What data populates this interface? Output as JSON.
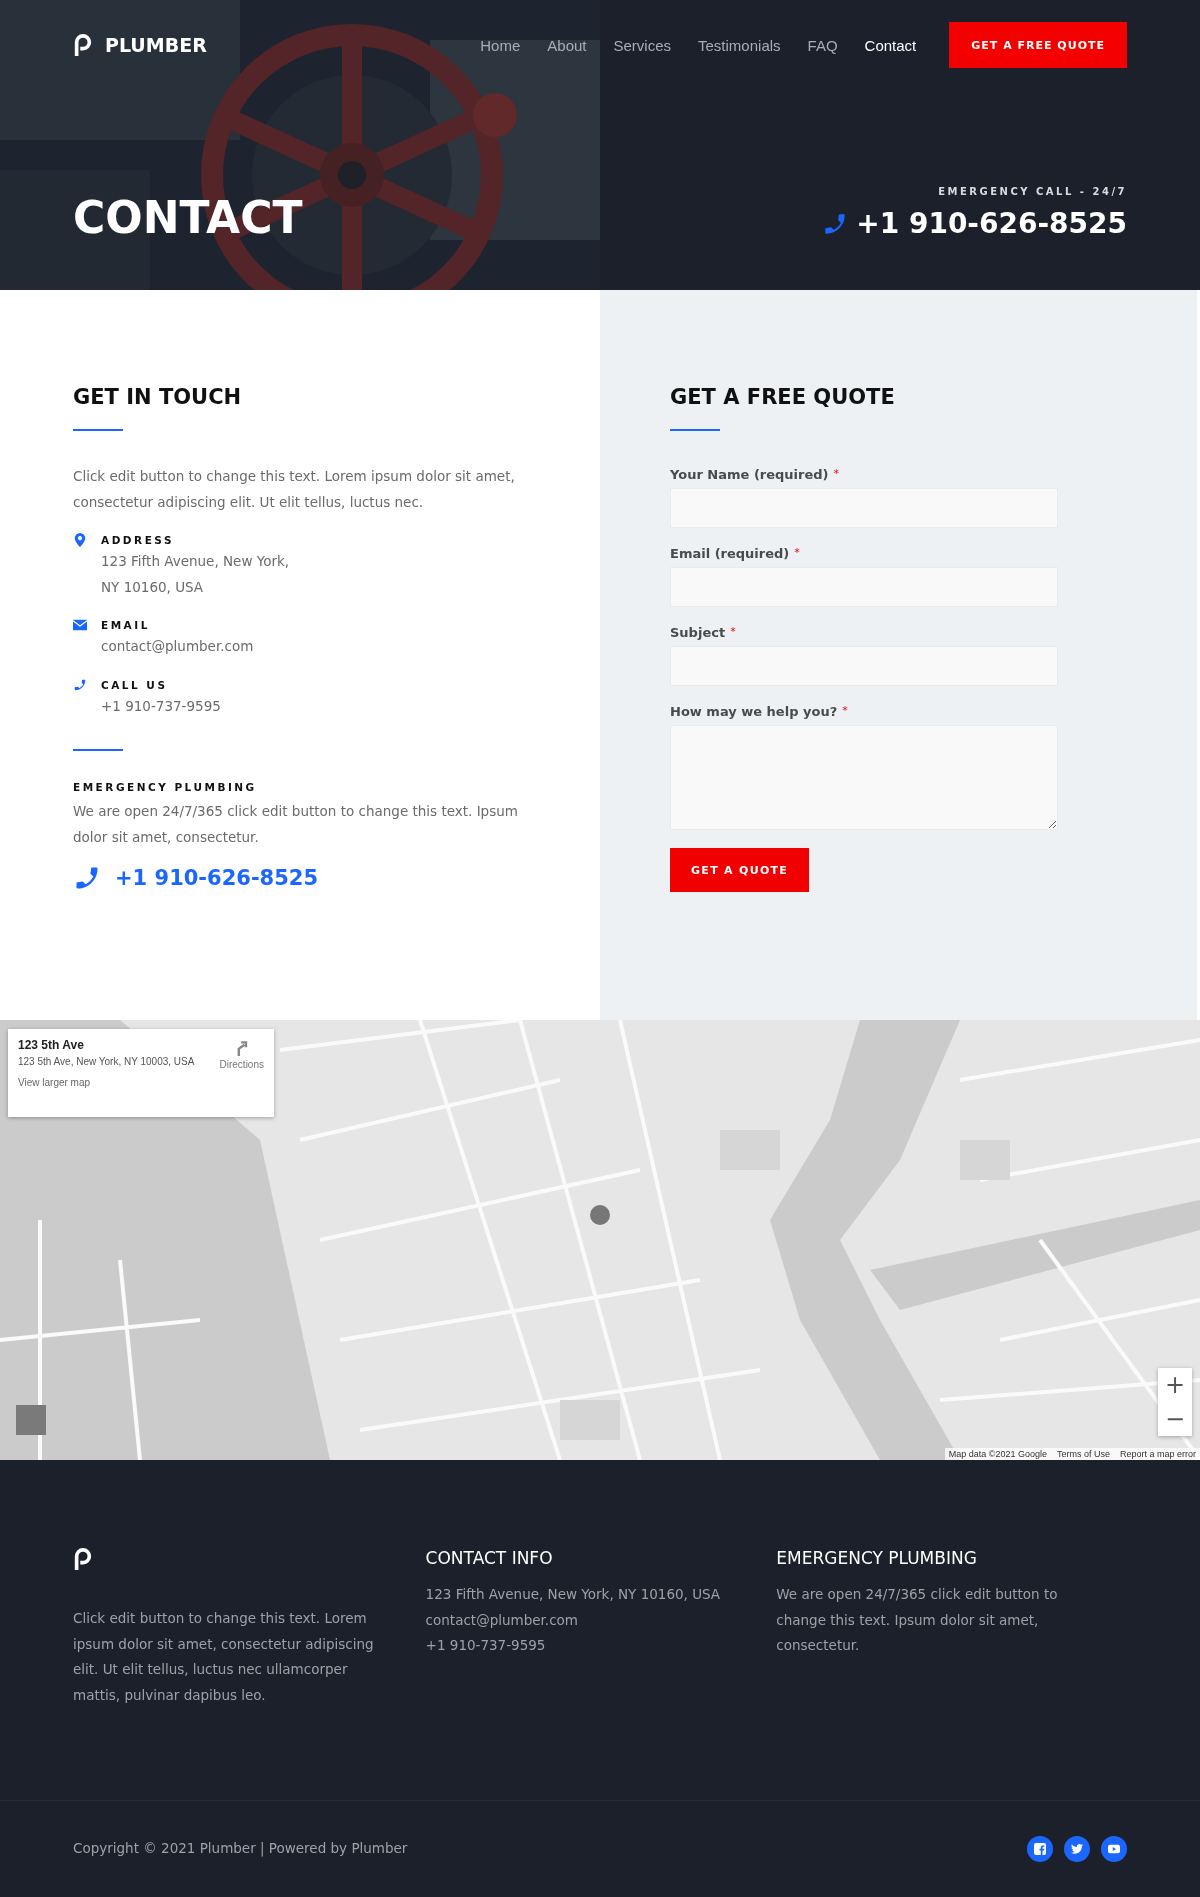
{
  "header": {
    "logo": "PLUMBER",
    "nav": [
      {
        "label": "Home",
        "selected": false
      },
      {
        "label": "About",
        "selected": false
      },
      {
        "label": "Services",
        "selected": false
      },
      {
        "label": "Testimonials",
        "selected": false
      },
      {
        "label": "FAQ",
        "selected": false
      },
      {
        "label": "Contact",
        "selected": true
      }
    ],
    "cta": "GET A FREE QUOTE",
    "page_title": "CONTACT",
    "emergency_label": "EMERGENCY CALL - 24/7",
    "emergency_phone": "+1 910-626-8525"
  },
  "get_in_touch": {
    "title": "GET IN TOUCH",
    "intro": "Click edit button to change this text. Lorem ipsum dolor sit amet, consectetur adipiscing elit. Ut elit tellus, luctus nec.",
    "items": [
      {
        "kind": "address",
        "label": "ADDRESS",
        "lines": [
          "123 Fifth Avenue, New York,",
          "NY 10160, USA"
        ]
      },
      {
        "kind": "email",
        "label": "EMAIL",
        "lines": [
          "contact@plumber.com"
        ]
      },
      {
        "kind": "phone",
        "label": "CALL US",
        "lines": [
          "+1 910-737-9595"
        ]
      }
    ],
    "emergency_title": "EMERGENCY PLUMBING",
    "emergency_text": "We are open 24/7/365 click edit button to change this text. Ipsum dolor sit amet, consectetur.",
    "phone": "+1 910-626-8525"
  },
  "quote_form": {
    "title": "GET A FREE QUOTE",
    "fields": [
      {
        "kind": "text",
        "label": "Your Name (required)",
        "required_mark": "*"
      },
      {
        "kind": "text",
        "label": "Email (required)",
        "required_mark": "*"
      },
      {
        "kind": "text",
        "label": "Subject",
        "required_mark": "*"
      },
      {
        "kind": "textarea",
        "label": "How may we help you?",
        "required_mark": "*"
      }
    ],
    "submit": "GET A QUOTE"
  },
  "map": {
    "place_title": "123 5th Ave",
    "place_address": "123 5th Ave, New York, NY 10003, USA",
    "directions": "Directions",
    "larger_map": "View larger map",
    "zoom_in": "+",
    "zoom_out": "−",
    "attribution": [
      "Map data ©2021 Google",
      "Terms of Use",
      "Report a map error"
    ]
  },
  "footer": {
    "about": "Click edit button to change this text. Lorem ipsum dolor sit amet, consectetur adipiscing elit. Ut elit tellus, luctus nec ullamcorper mattis, pulvinar dapibus leo.",
    "contact_title": "CONTACT INFO",
    "contact_lines": [
      "123 Fifth Avenue, New York, NY 10160, USA",
      "contact@plumber.com",
      "+1 910-737-9595"
    ],
    "emergency_title": "EMERGENCY PLUMBING",
    "emergency_text": "We are open 24/7/365 click edit button to change this text. Ipsum dolor sit amet, consectetur.",
    "copyright": "Copyright © 2021 Plumber | Powered by Plumber",
    "social": [
      {
        "kind": "facebook"
      },
      {
        "kind": "twitter"
      },
      {
        "kind": "youtube"
      }
    ]
  }
}
